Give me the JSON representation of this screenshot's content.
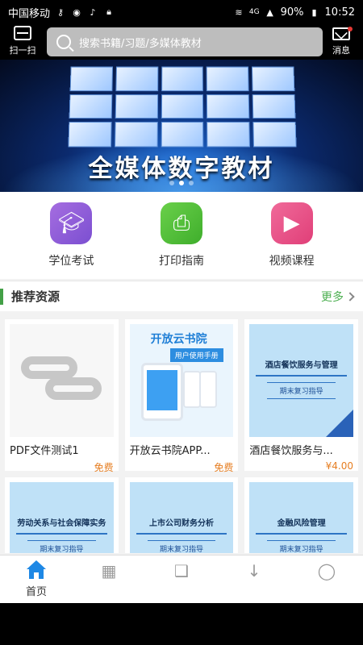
{
  "status_bar": {
    "carrier": "中国移动",
    "battery": "90%",
    "time": "10:52",
    "signal": "4G"
  },
  "header": {
    "scan_label": "扫一扫",
    "search_placeholder": "搜索书籍/习题/多媒体教材",
    "message_label": "消息"
  },
  "banner": {
    "title": "全媒体数字教材"
  },
  "quick_menu": [
    {
      "label": "学位考试",
      "icon": "graduation-cap-icon",
      "color": "#8a5bd9"
    },
    {
      "label": "打印指南",
      "icon": "printer-icon",
      "color": "#4dbb34"
    },
    {
      "label": "视频课程",
      "icon": "tv-icon",
      "color": "#e8527f"
    }
  ],
  "recommend": {
    "title": "推荐资源",
    "more_label": "更多"
  },
  "cards": [
    {
      "name": "PDF文件测试1",
      "price": "免费"
    },
    {
      "name": "开放云书院APP...",
      "price": "免费",
      "cover_title": "开放云书院",
      "cover_sub": "用户使用手册"
    },
    {
      "name": "酒店餐饮服务与...",
      "price": "¥4.00",
      "cover_title": "酒店餐饮服务与管理",
      "cover_sub": "期末复习指导"
    },
    {
      "cover_title": "劳动关系与社会保障实务",
      "cover_sub": "期末复习指导"
    },
    {
      "cover_title": "上市公司财务分析",
      "cover_sub": "期末复习指导"
    },
    {
      "cover_title": "金融风险管理",
      "cover_sub": "期末复习指导"
    }
  ],
  "bottom_nav": {
    "home_label": "首页"
  },
  "colors": {
    "accent_green": "#43a047",
    "price_orange": "#e67e22",
    "home_blue": "#1e88e5"
  }
}
